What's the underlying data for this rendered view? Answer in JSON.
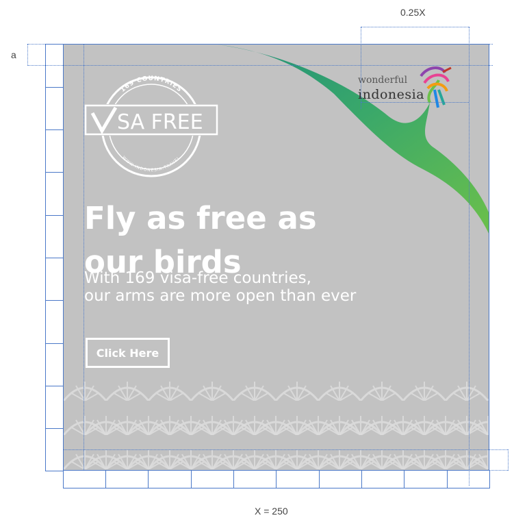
{
  "dimensions": {
    "width_label": "X = 250",
    "logo_width_label": "0.25X",
    "margin_label": "a"
  },
  "banner": {
    "badge": {
      "arc_text": "169 COUNTRIES",
      "main_text": "SA FREE",
      "bottom_text": "WWW.INDONESIA.TRAVEL"
    },
    "logo": {
      "line1": "wonderful",
      "line2": "indonesia"
    },
    "headline_lines": [
      "Fly as free as",
      "our birds"
    ],
    "subhead_lines": [
      "With 169 visa-free countries,",
      "our arms are more open than ever"
    ],
    "cta_label": "Click Here"
  },
  "colors": {
    "banner_bg": "#c2c2c2",
    "grid_line": "#4a78c8",
    "swoosh_teal": "#1f8f7a",
    "swoosh_green": "#6cc04a",
    "text": "#ffffff"
  }
}
